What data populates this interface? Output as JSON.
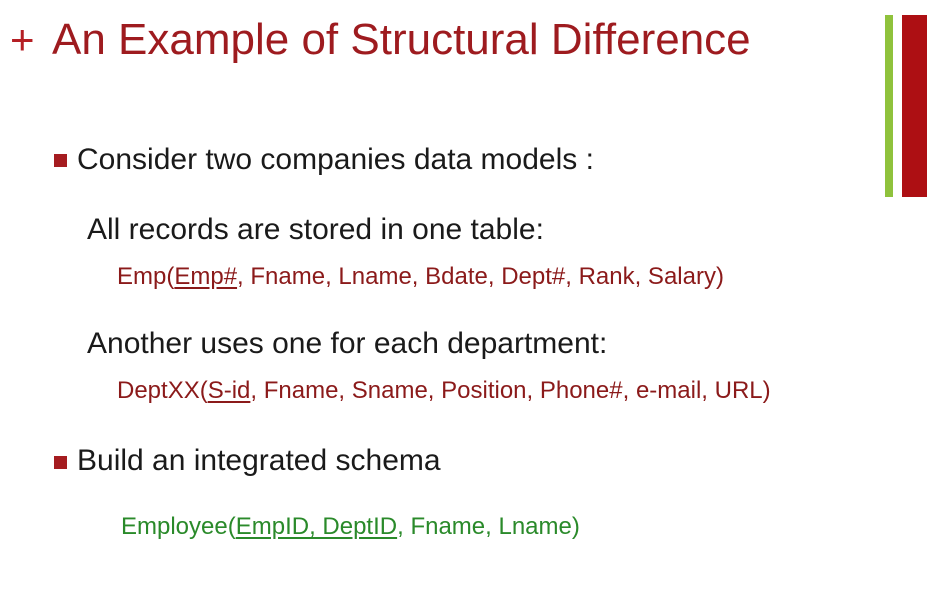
{
  "slide": {
    "plus": "+",
    "title": "An Example of Structural Difference",
    "bullet1": "Consider two companies data models :",
    "sub1": "All records are stored in one table:",
    "schema1": {
      "prefix": "Emp(",
      "key": "Emp#",
      "rest": ", Fname, Lname, Bdate, Dept#, Rank, Salary)"
    },
    "sub2": "Another uses one for each department:",
    "schema2": {
      "prefix": "DeptXX(",
      "key": "S-id",
      "rest": ", Fname,  Sname, Position, Phone#, e-mail, URL)"
    },
    "bullet2": "Build an integrated schema",
    "schema3": {
      "prefix": "Employee(",
      "key": "EmpID, DeptID",
      "rest": ", Fname, Lname)"
    }
  },
  "colors": {
    "title": "#9e1b1f",
    "accent_green": "#8fc23c",
    "accent_red": "#ad0f13",
    "schema_red": "#8b1a1a",
    "schema_green": "#2a8a2a"
  }
}
